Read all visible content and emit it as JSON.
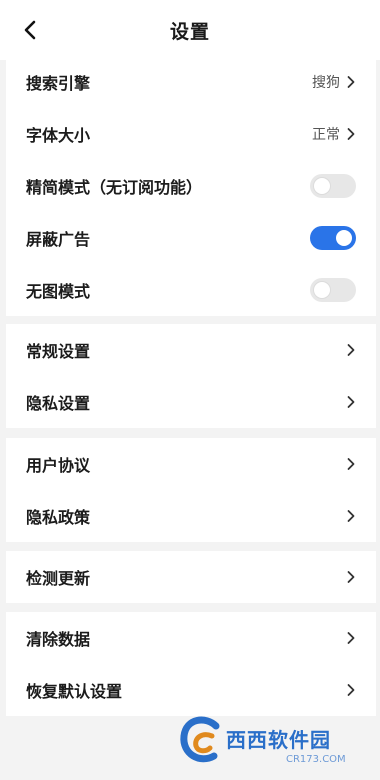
{
  "header": {
    "title": "设置"
  },
  "group1": {
    "search_engine": {
      "label": "搜索引擎",
      "value": "搜狗"
    },
    "font_size": {
      "label": "字体大小",
      "value": "正常"
    },
    "simple_mode": {
      "label": "精简模式（无订阅功能）",
      "on": false
    },
    "block_ads": {
      "label": "屏蔽广告",
      "on": true
    },
    "no_image_mode": {
      "label": "无图模式",
      "on": false
    }
  },
  "group2": {
    "general": {
      "label": "常规设置"
    },
    "privacy": {
      "label": "隐私设置"
    }
  },
  "group3": {
    "agreement": {
      "label": "用户协议"
    },
    "privacy_policy": {
      "label": "隐私政策"
    }
  },
  "group4": {
    "check_update": {
      "label": "检测更新"
    }
  },
  "group5": {
    "clear_data": {
      "label": "清除数据"
    },
    "restore_defaults": {
      "label": "恢复默认设置"
    }
  },
  "watermark": {
    "text": "西西软件园",
    "sub": "CR173.COM"
  },
  "colors": {
    "accent": "#2a74e8",
    "toggle_off": "#e7e7e7",
    "background": "#f3f3f3"
  }
}
